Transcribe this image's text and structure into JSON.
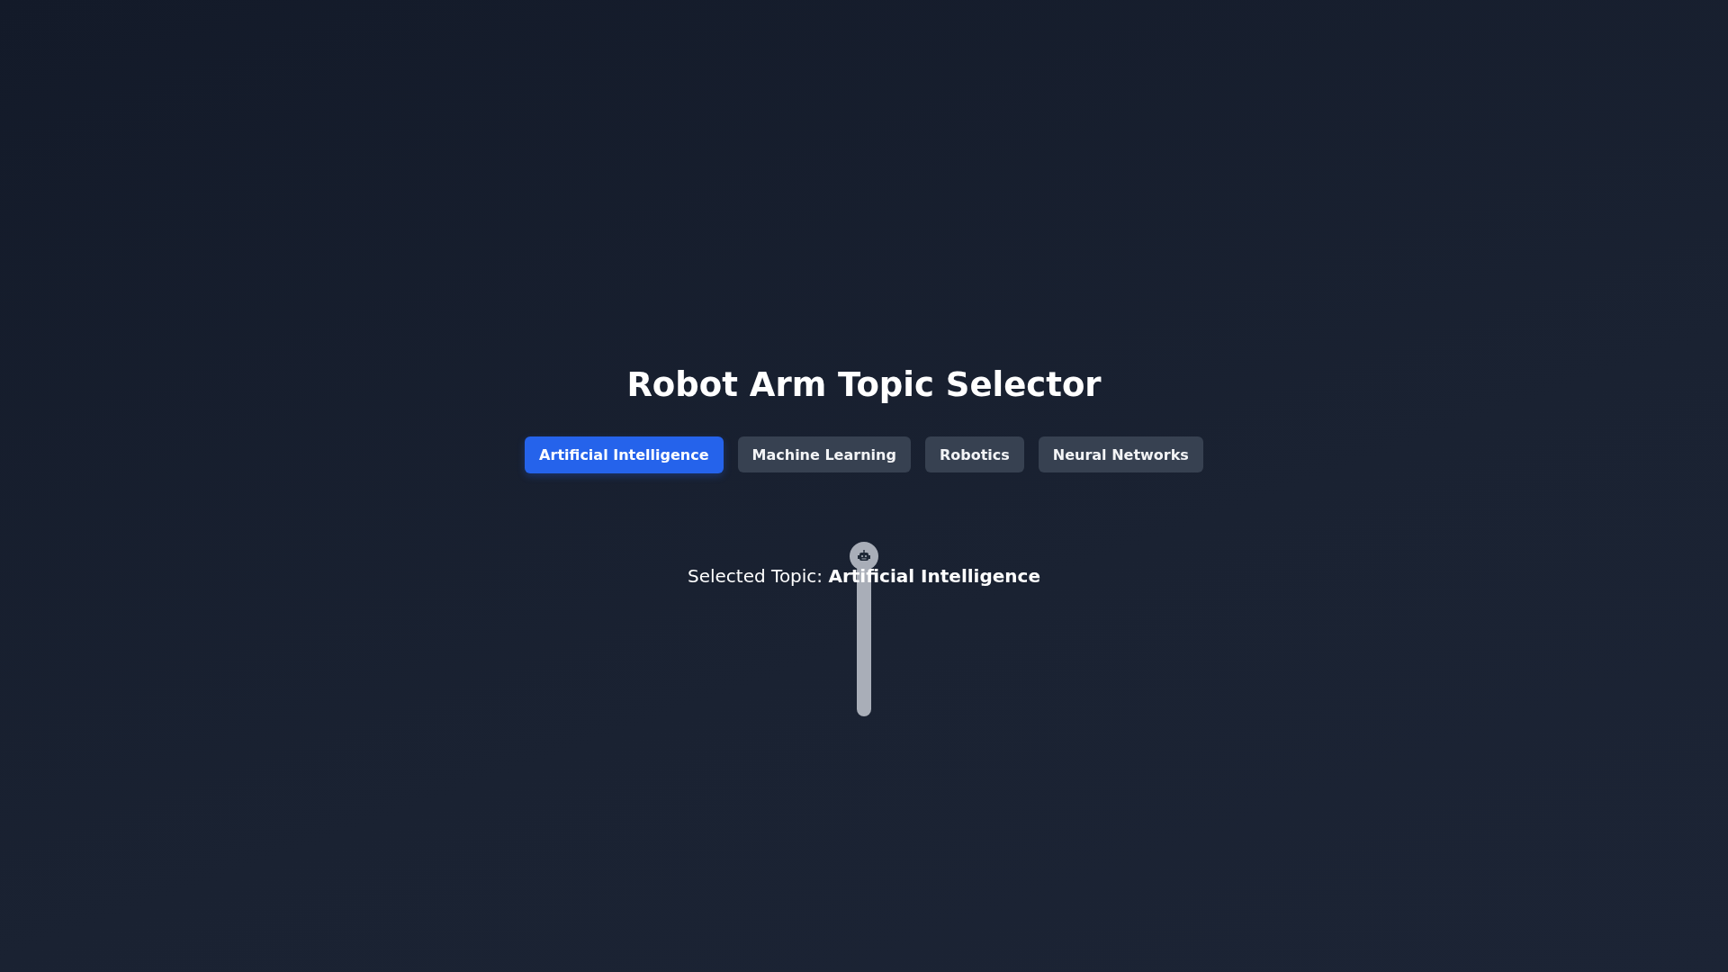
{
  "title": "Robot Arm Topic Selector",
  "topics": [
    {
      "label": "Artificial Intelligence",
      "selected": true
    },
    {
      "label": "Machine Learning",
      "selected": false
    },
    {
      "label": "Robotics",
      "selected": false
    },
    {
      "label": "Neural Networks",
      "selected": false
    }
  ],
  "selected_topic": {
    "label": "Selected Topic:",
    "value": "Artificial Intelligence"
  }
}
